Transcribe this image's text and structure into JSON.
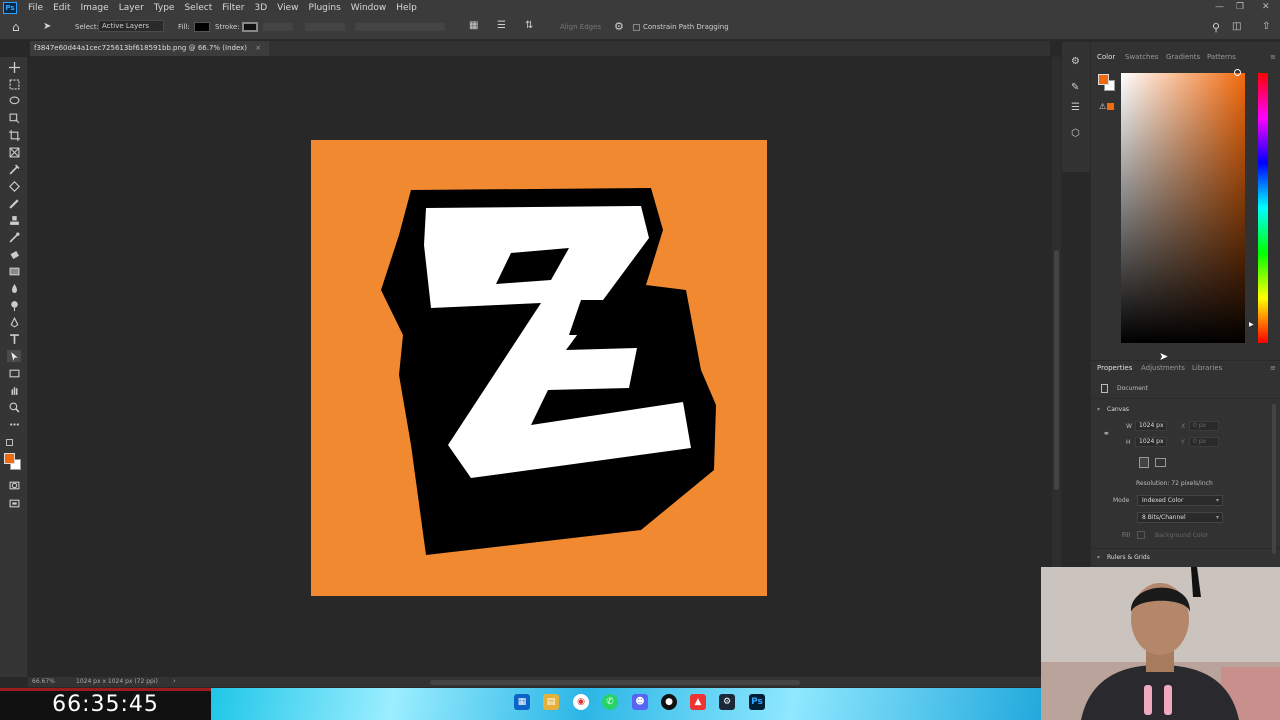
{
  "app": {
    "logo": "Ps",
    "menus": [
      "File",
      "Edit",
      "Image",
      "Layer",
      "Type",
      "Select",
      "Filter",
      "3D",
      "View",
      "Plugins",
      "Window",
      "Help"
    ]
  },
  "options_bar": {
    "select_label": "Select:",
    "select_value": "Active Layers",
    "fill_label": "Fill:",
    "stroke_label": "Stroke:",
    "align_edges": "Align Edges",
    "constrain": "Constrain Path Dragging"
  },
  "document": {
    "tab_title": "f3847e60d44a1cec725613bf618591bb.png @ 66.7% (Index)",
    "close": "×"
  },
  "status": {
    "zoom": "66.67%",
    "doc_info": "1024 px x 1024 px (72 ppi)"
  },
  "color_panel": {
    "tabs": [
      "Color",
      "Swatches",
      "Gradients",
      "Patterns"
    ],
    "foreground": "#f26a0d"
  },
  "properties_panel": {
    "tabs": [
      "Properties",
      "Adjustments",
      "Libraries"
    ],
    "document_label": "Document",
    "canvas_section": "Canvas",
    "w_label": "W",
    "w_value": "1024 px",
    "h_label": "H",
    "h_value": "1024 px",
    "x_label": "X",
    "x_value": "0 px",
    "y_label": "Y",
    "y_value": "0 px",
    "resolution": "Resolution: 72 pixels/inch",
    "mode_label": "Mode",
    "mode_value": "Indexed Color",
    "bits_value": "8 Bits/Channel",
    "fill_label": "Fill",
    "fill_value": "Background Color",
    "rulers_section": "Rulers & Grids"
  },
  "clock": "66:35:45",
  "colors": {
    "artboard": "#f0892f",
    "accent_blue": "#2fa3ff"
  }
}
